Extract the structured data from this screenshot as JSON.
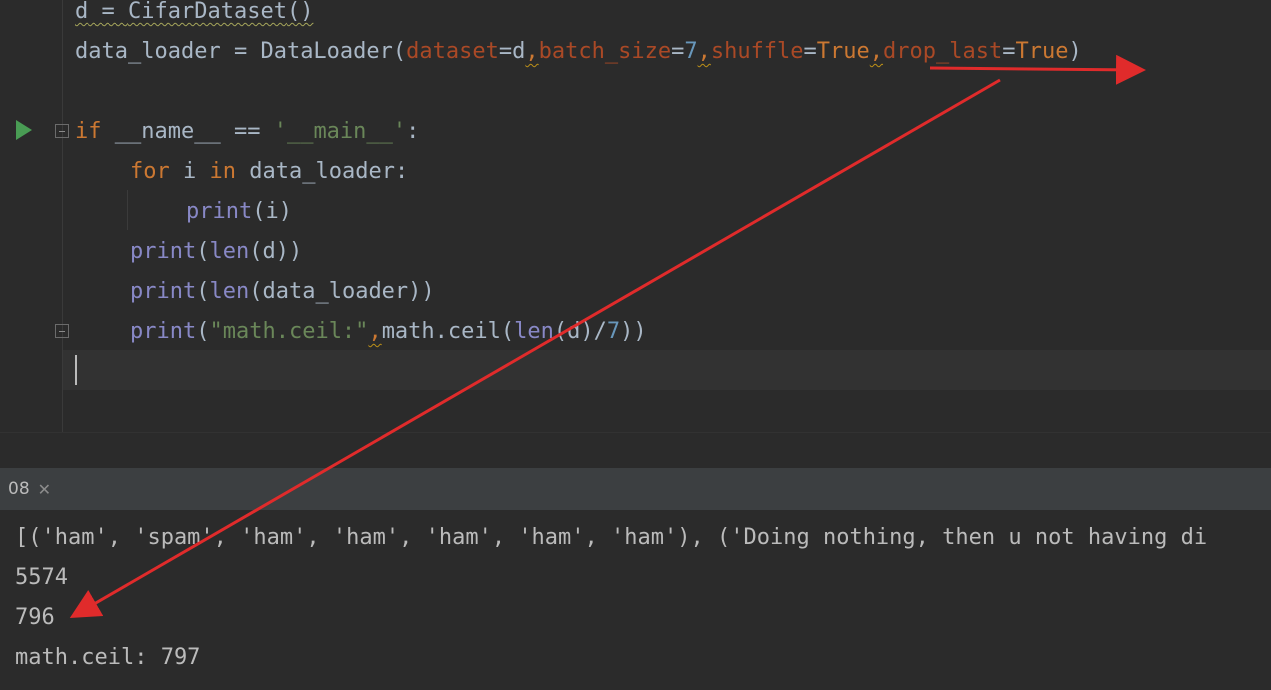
{
  "editor": {
    "lines": {
      "l1": {
        "d": "d",
        "eq": " = ",
        "cls": "CifarDataset",
        "call": "()"
      },
      "l2": {
        "var": "data_loader",
        "eq": " = ",
        "cls": "DataLoader",
        "open": "(",
        "p1": "dataset",
        "e1": "=",
        "v1": "d",
        "c1": ",",
        "p2": "batch_size",
        "e2": "=",
        "v2": "7",
        "c2": ",",
        "p3": "shuffle",
        "e3": "=",
        "v3": "True",
        "c3": ",",
        "p4": "drop_last",
        "e4": "=",
        "v4": "True",
        "close": ")"
      },
      "l4": {
        "kw": "if",
        "name": " __name__ ",
        "op": "== ",
        "str": "'__main__'",
        "colon": ":"
      },
      "l5": {
        "kw1": "for",
        "i": " i ",
        "kw2": "in",
        "rest": " data_loader:"
      },
      "l6": {
        "fn": "print",
        "rest": "(i)"
      },
      "l7": {
        "fn": "print",
        "open": "(",
        "fn2": "len",
        "rest": "(d))"
      },
      "l8": {
        "fn": "print",
        "open": "(",
        "fn2": "len",
        "rest": "(data_loader))"
      },
      "l9": {
        "fn": "print",
        "open": "(",
        "str": "\"math.ceil:\"",
        "comma": ",",
        "mid": "math.ceil(",
        "fn2": "len",
        "mid2": "(d)/",
        "num": "7",
        "close": "))"
      }
    }
  },
  "run_panel": {
    "tab_label": "08",
    "close_glyph": "✕"
  },
  "console": {
    "lines": [
      "[('ham', 'spam', 'ham', 'ham', 'ham', 'ham', 'ham'), ('Doing nothing, then u not having di",
      "5574",
      "796",
      "math.ceil: 797"
    ]
  },
  "colors": {
    "annotation": "#e02b2b"
  }
}
